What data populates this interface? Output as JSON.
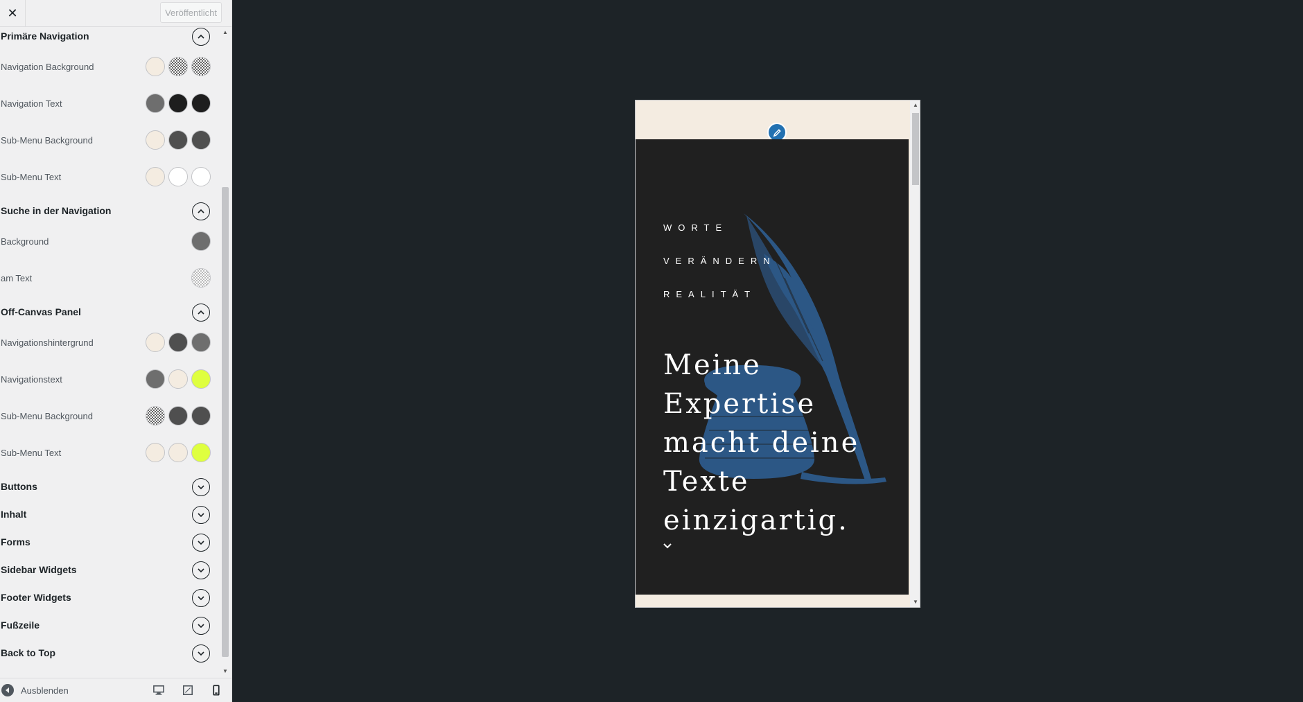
{
  "topbar": {
    "close_label": "✕",
    "publish_label": "Veröffentlicht"
  },
  "sections": {
    "primary_nav": {
      "title": "Primäre Navigation",
      "rows": [
        {
          "label": "Navigation Background"
        },
        {
          "label": "Navigation Text"
        },
        {
          "label": "Sub-Menu Background"
        },
        {
          "label": "Sub-Menu Text"
        }
      ]
    },
    "nav_search": {
      "title": "Suche in der Navigation",
      "rows": [
        {
          "label": "Background"
        },
        {
          "label": "am Text"
        }
      ]
    },
    "offcanvas": {
      "title": "Off-Canvas Panel",
      "rows": [
        {
          "label": "Navigationshintergrund"
        },
        {
          "label": "Navigationstext"
        },
        {
          "label": "Sub-Menu Background"
        },
        {
          "label": "Sub-Menu Text"
        }
      ]
    },
    "collapsed": [
      "Buttons",
      "Inhalt",
      "Forms",
      "Sidebar Widgets",
      "Footer Widgets",
      "Fußzeile",
      "Back to Top"
    ]
  },
  "footer": {
    "hide_label": "Ausblenden"
  },
  "preview": {
    "words": [
      "WORTE",
      "VERÄNDERN",
      "REALITÄT"
    ],
    "heading": "Meine Expertise macht deine Texte einzigartig."
  },
  "colors": {
    "cream": "#f4ece1",
    "dark": "#1e1e1e",
    "gray": "#6e6e6e",
    "darkgray": "#4f4f4f",
    "white": "#ffffff",
    "lime": "#dfff3f",
    "quill": "#2d5a8b",
    "accent": "#2271b1"
  }
}
